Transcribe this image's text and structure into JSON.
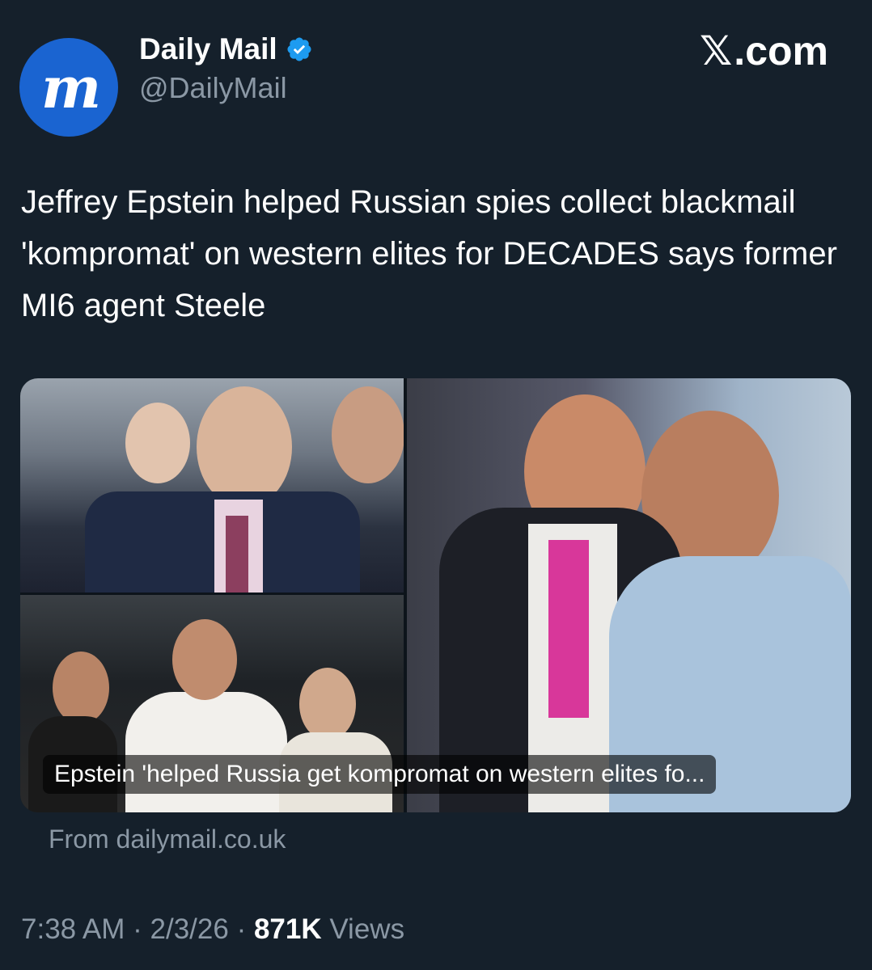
{
  "account": {
    "name": "Daily Mail",
    "handle": "@DailyMail",
    "avatar_letters": "M"
  },
  "brand": {
    "site": ".com",
    "accent": "#1d9bf0"
  },
  "tweet": {
    "text": "Jeffrey Epstein helped Russian spies collect blackmail 'kompromat' on western elites for DECADES says former MI6 agent Steele"
  },
  "card": {
    "caption": "Epstein 'helped Russia get kompromat on western elites fo...",
    "source": "From dailymail.co.uk"
  },
  "meta": {
    "time": "7:38 AM",
    "sep1": " · ",
    "date": "2/3/26",
    "sep2": " · ",
    "views_count": "871K",
    "views_label": " Views"
  }
}
